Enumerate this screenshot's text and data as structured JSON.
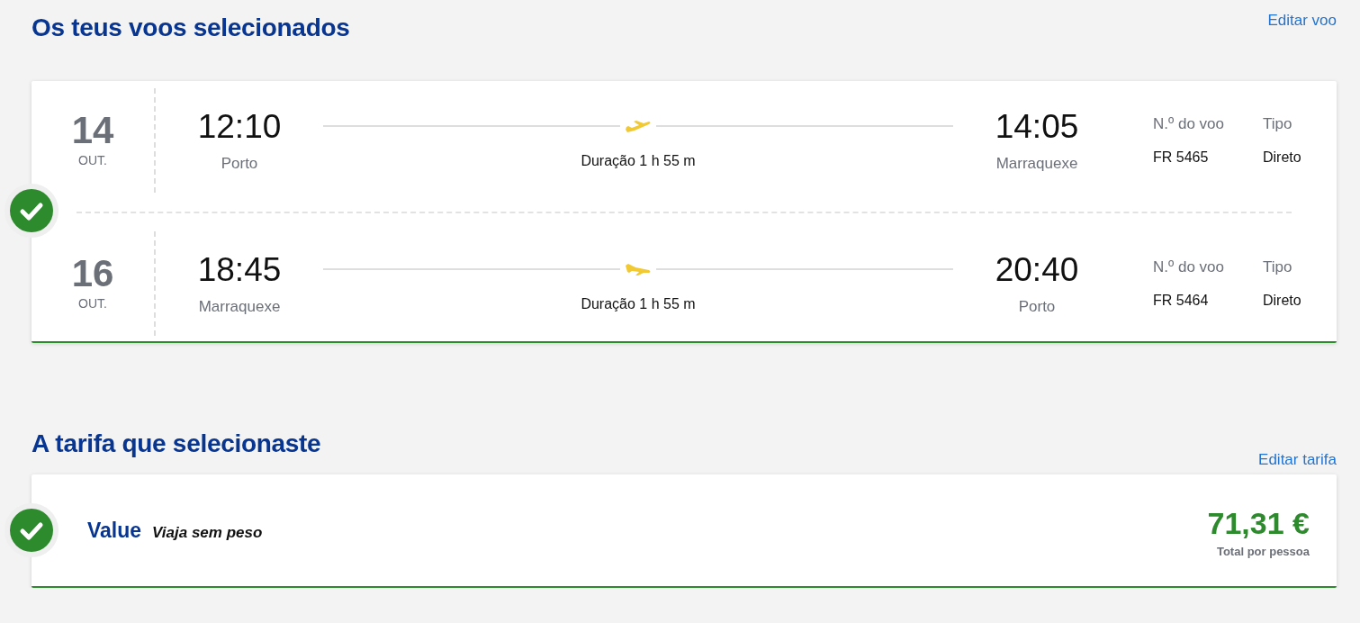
{
  "flights_section": {
    "title": "Os teus voos selecionados",
    "edit_link": "Editar voo",
    "confirmed": true,
    "flights": [
      {
        "kind": "outbound",
        "day": "14",
        "month": "OUT.",
        "departure_time": "12:10",
        "departure_city": "Porto",
        "duration": "Duração 1 h 55 m",
        "arrival_time": "14:05",
        "arrival_city": "Marraquexe",
        "flight_number_label": "N.º do voo",
        "flight_number": "FR 5465",
        "type_label": "Tipo",
        "type": "Direto"
      },
      {
        "kind": "inbound",
        "day": "16",
        "month": "OUT.",
        "departure_time": "18:45",
        "departure_city": "Marraquexe",
        "duration": "Duração 1 h 55 m",
        "arrival_time": "20:40",
        "arrival_city": "Porto",
        "flight_number_label": "N.º do voo",
        "flight_number": "FR 5464",
        "type_label": "Tipo",
        "type": "Direto"
      }
    ]
  },
  "fare_section": {
    "title": "A tarifa que selecionaste",
    "edit_link": "Editar tarifa",
    "confirmed": true,
    "fare_name": "Value",
    "fare_description": "Viaja sem peso",
    "price": "71,31 €",
    "price_note": "Total por pessoa"
  }
}
